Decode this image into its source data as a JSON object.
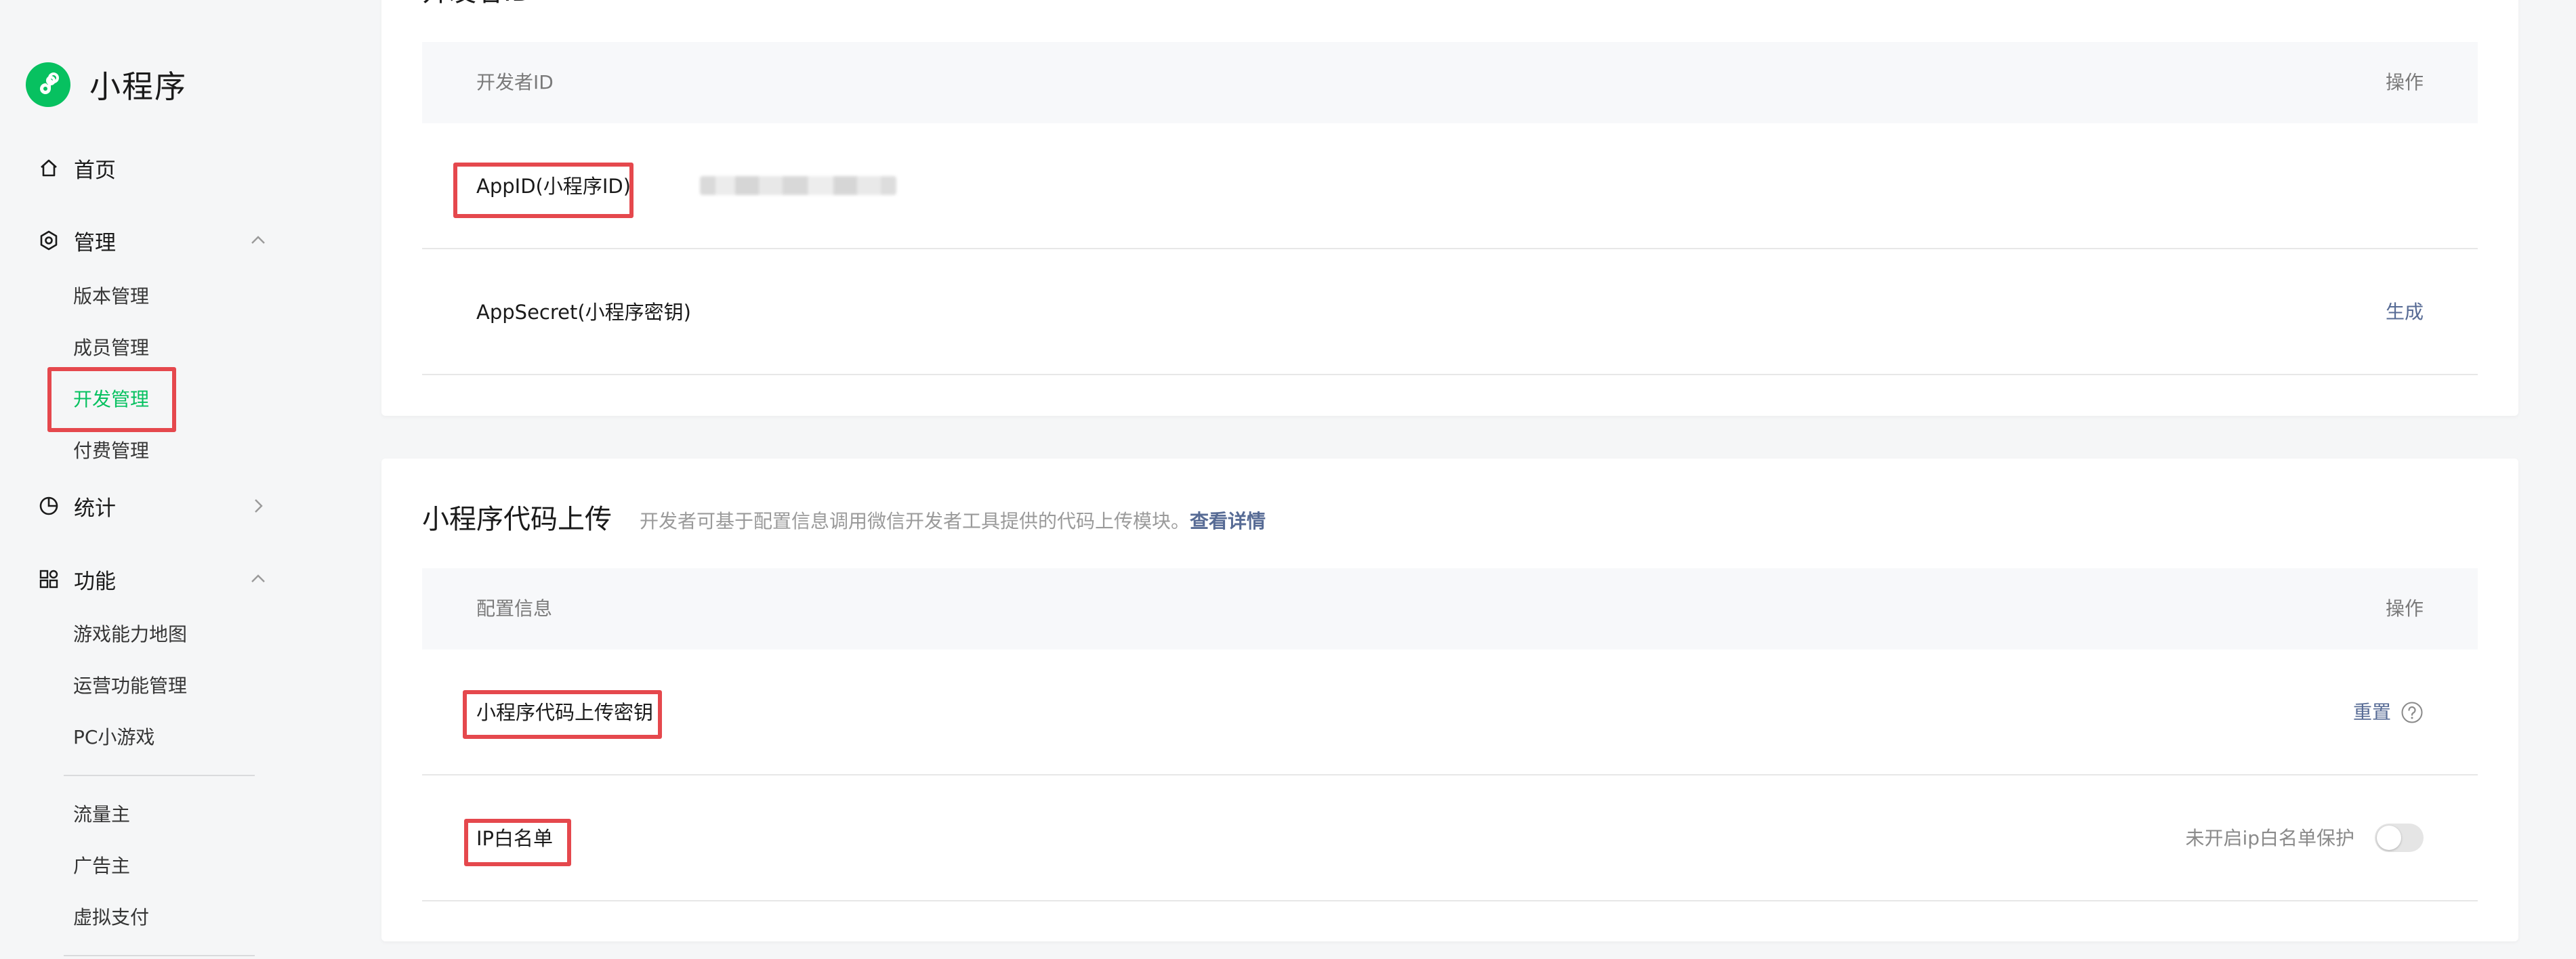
{
  "app": {
    "title": "小程序",
    "brand_color": "#07c160",
    "logo_icon": "miniprogram-logo-icon"
  },
  "sidebar": {
    "home": {
      "label": "首页",
      "icon": "home-icon"
    },
    "manage": {
      "label": "管理",
      "icon": "gear-icon",
      "expanded": true,
      "items": [
        {
          "label": "版本管理",
          "active": false
        },
        {
          "label": "成员管理",
          "active": false
        },
        {
          "label": "开发管理",
          "active": true
        },
        {
          "label": "付费管理",
          "active": false
        }
      ]
    },
    "stats": {
      "label": "统计",
      "icon": "pie-chart-icon",
      "expanded": false
    },
    "features": {
      "label": "功能",
      "icon": "grid-icon",
      "expanded": true,
      "items": [
        {
          "label": "游戏能力地图"
        },
        {
          "label": "运营功能管理"
        },
        {
          "label": "PC小游戏"
        }
      ],
      "items2": [
        {
          "label": "流量主"
        },
        {
          "label": "广告主"
        },
        {
          "label": "虚拟支付"
        }
      ]
    }
  },
  "dev_id_section": {
    "title": "开发者ID",
    "table": {
      "header_left": "开发者ID",
      "header_right": "操作",
      "rows": [
        {
          "label": "AppID(小程序ID)",
          "value": "",
          "value_obscured": true,
          "action": ""
        },
        {
          "label": "AppSecret(小程序密钥)",
          "value": "",
          "action": "生成"
        }
      ]
    }
  },
  "upload_section": {
    "title": "小程序代码上传",
    "description": "开发者可基于配置信息调用微信开发者工具提供的代码上传模块。",
    "details_link": "查看详情",
    "table": {
      "header_left": "配置信息",
      "header_right": "操作",
      "rows": [
        {
          "label": "小程序代码上传密钥",
          "action": "重置",
          "help_icon": "question-circle-icon"
        },
        {
          "label": "IP白名单",
          "status": "未开启ip白名单保护",
          "toggle_on": false
        }
      ]
    }
  },
  "colors": {
    "link": "#576b95",
    "highlight_box": "#e5484d",
    "page_bg": "#f5f6f7",
    "card_bg": "#ffffff"
  }
}
